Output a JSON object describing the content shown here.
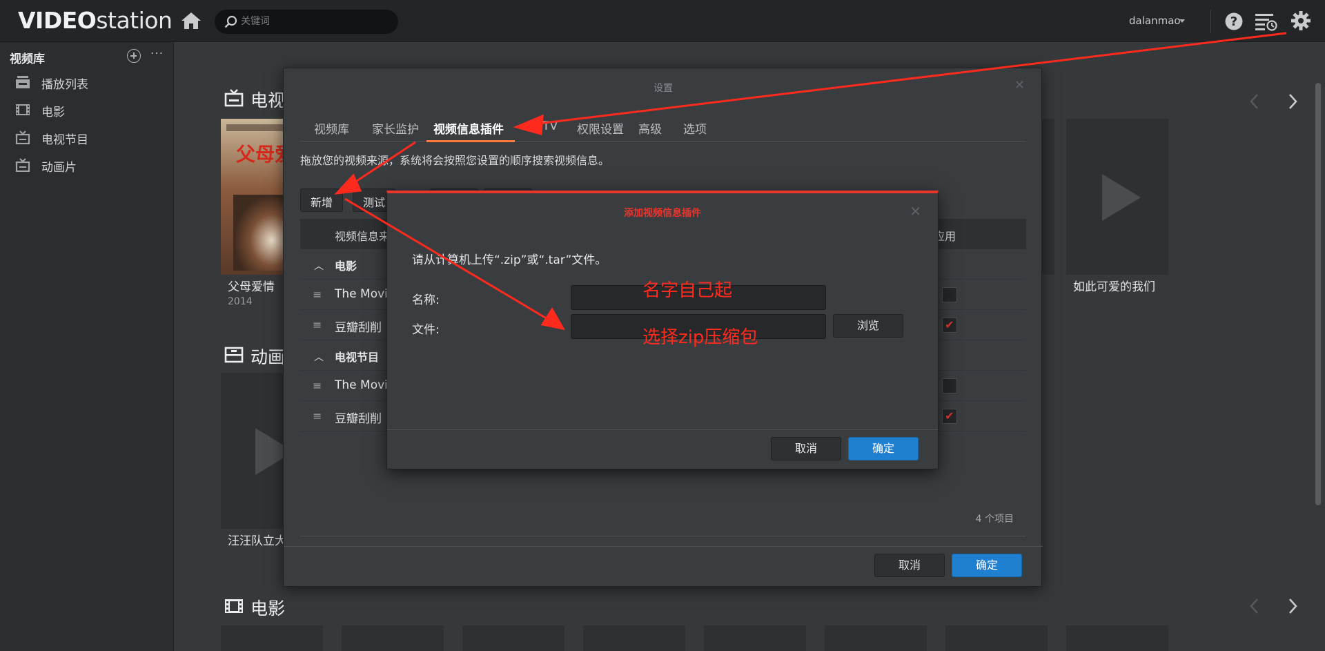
{
  "app": {
    "logo_bold": "VIDEO",
    "logo_thin": "station",
    "search_placeholder": "关键词",
    "user": "dalanmao"
  },
  "sidebar": {
    "title": "视频库",
    "items": [
      {
        "label": "播放列表",
        "icon": "playlist-icon"
      },
      {
        "label": "电影",
        "icon": "film-icon"
      },
      {
        "label": "电视节目",
        "icon": "tv-icon"
      },
      {
        "label": "动画片",
        "icon": "tv-icon"
      }
    ]
  },
  "background": {
    "sections": [
      {
        "title": "电视"
      },
      {
        "title": "动画"
      },
      {
        "title": "电影"
      }
    ],
    "cards": [
      {
        "title": "父母爱情",
        "year": "2014"
      },
      {
        "title": "如此可爱的我们"
      },
      {
        "title": "汪汪队立大"
      }
    ],
    "poster_text": "父母爱"
  },
  "settings_modal": {
    "title": "设置",
    "tabs": [
      "视频库",
      "家长监护",
      "视频信息插件",
      "DTV",
      "权限设置",
      "高级",
      "选项"
    ],
    "active_tab": 2,
    "description": "拖放您的视频来源，系统将会按照您设置的顺序搜索视频信息。",
    "toolbar": {
      "add": "新增",
      "test": "测试"
    },
    "table": {
      "col_name": "视频信息来",
      "col_apply": "应用",
      "groups": [
        {
          "label": "电影",
          "items": [
            {
              "label": "The Movie",
              "checked": false
            },
            {
              "label": "豆瓣刮削",
              "checked": true
            }
          ]
        },
        {
          "label": "电视节目",
          "items": [
            {
              "label": "The Movie",
              "checked": false
            },
            {
              "label": "豆瓣刮削",
              "checked": true
            }
          ]
        }
      ]
    },
    "count": "4 个项目",
    "cancel": "取消",
    "ok": "确定"
  },
  "add_dialog": {
    "title": "添加视频信息插件",
    "description": "请从计算机上传“.zip”或“.tar”文件。",
    "name_label": "名称:",
    "file_label": "文件:",
    "browse": "浏览",
    "cancel": "取消",
    "ok": "确定"
  },
  "annotations": {
    "name_hint": "名字自己起",
    "file_hint": "选择zip压缩包",
    "color": "#ff2a1e"
  },
  "colors": {
    "accent_blue": "#1f7fd0",
    "dialog_red": "#e8352e",
    "tab_underline": "#ff7a3c"
  }
}
